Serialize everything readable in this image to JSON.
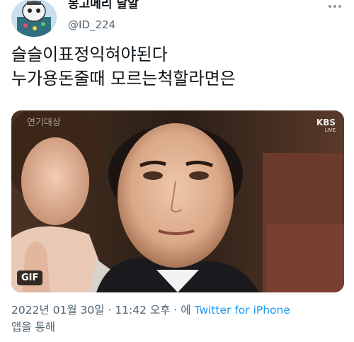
{
  "author": {
    "display_name": "몽고메리 날알",
    "handle": "@ID_224",
    "avatar_icon": "cartoon-avatar"
  },
  "tweet": {
    "text_line1": "슬슬이표정익혀야된다",
    "text_line2": "누가용돈줄때 모르는척할라면은"
  },
  "media": {
    "type": "GIF",
    "gif_label": "GIF",
    "overlay_title": "연기대상",
    "broadcaster": "KBS",
    "broadcaster_sub": "LIVE"
  },
  "meta": {
    "date": "2022년 01월 30일",
    "separator": "·",
    "time": "11:42 오후",
    "via_prefix": "· 에",
    "client": "Twitter for iPhone",
    "via_suffix": "앱을 통해"
  },
  "colors": {
    "link": "#1d9bf0",
    "secondary_text": "#536471",
    "primary_text": "#0f1419"
  }
}
